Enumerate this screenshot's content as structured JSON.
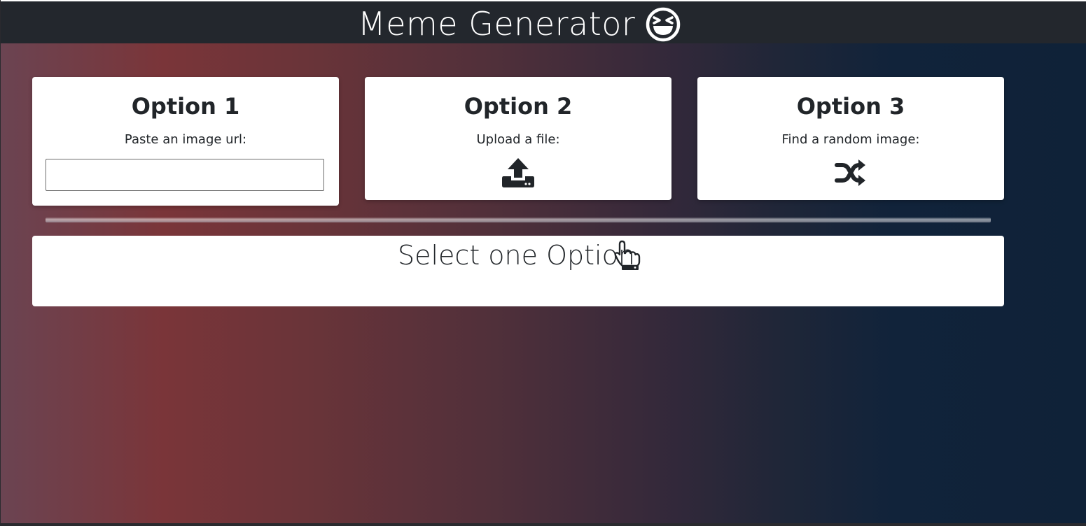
{
  "header": {
    "title": "Meme Generator",
    "emoji_icon": "laughing-face-icon"
  },
  "options": [
    {
      "title": "Option 1",
      "subtitle": "Paste an image url:",
      "input": {
        "value": "",
        "placeholder": ""
      }
    },
    {
      "title": "Option 2",
      "subtitle": "Upload a file:",
      "icon": "upload-icon"
    },
    {
      "title": "Option 3",
      "subtitle": "Find a random image:",
      "icon": "shuffle-icon"
    }
  ],
  "result": {
    "text": "Select one Option",
    "icon": "hand-pointer-icon"
  },
  "colors": {
    "header_bg": "#23272d",
    "card_bg": "#ffffff",
    "text": "#212529"
  }
}
